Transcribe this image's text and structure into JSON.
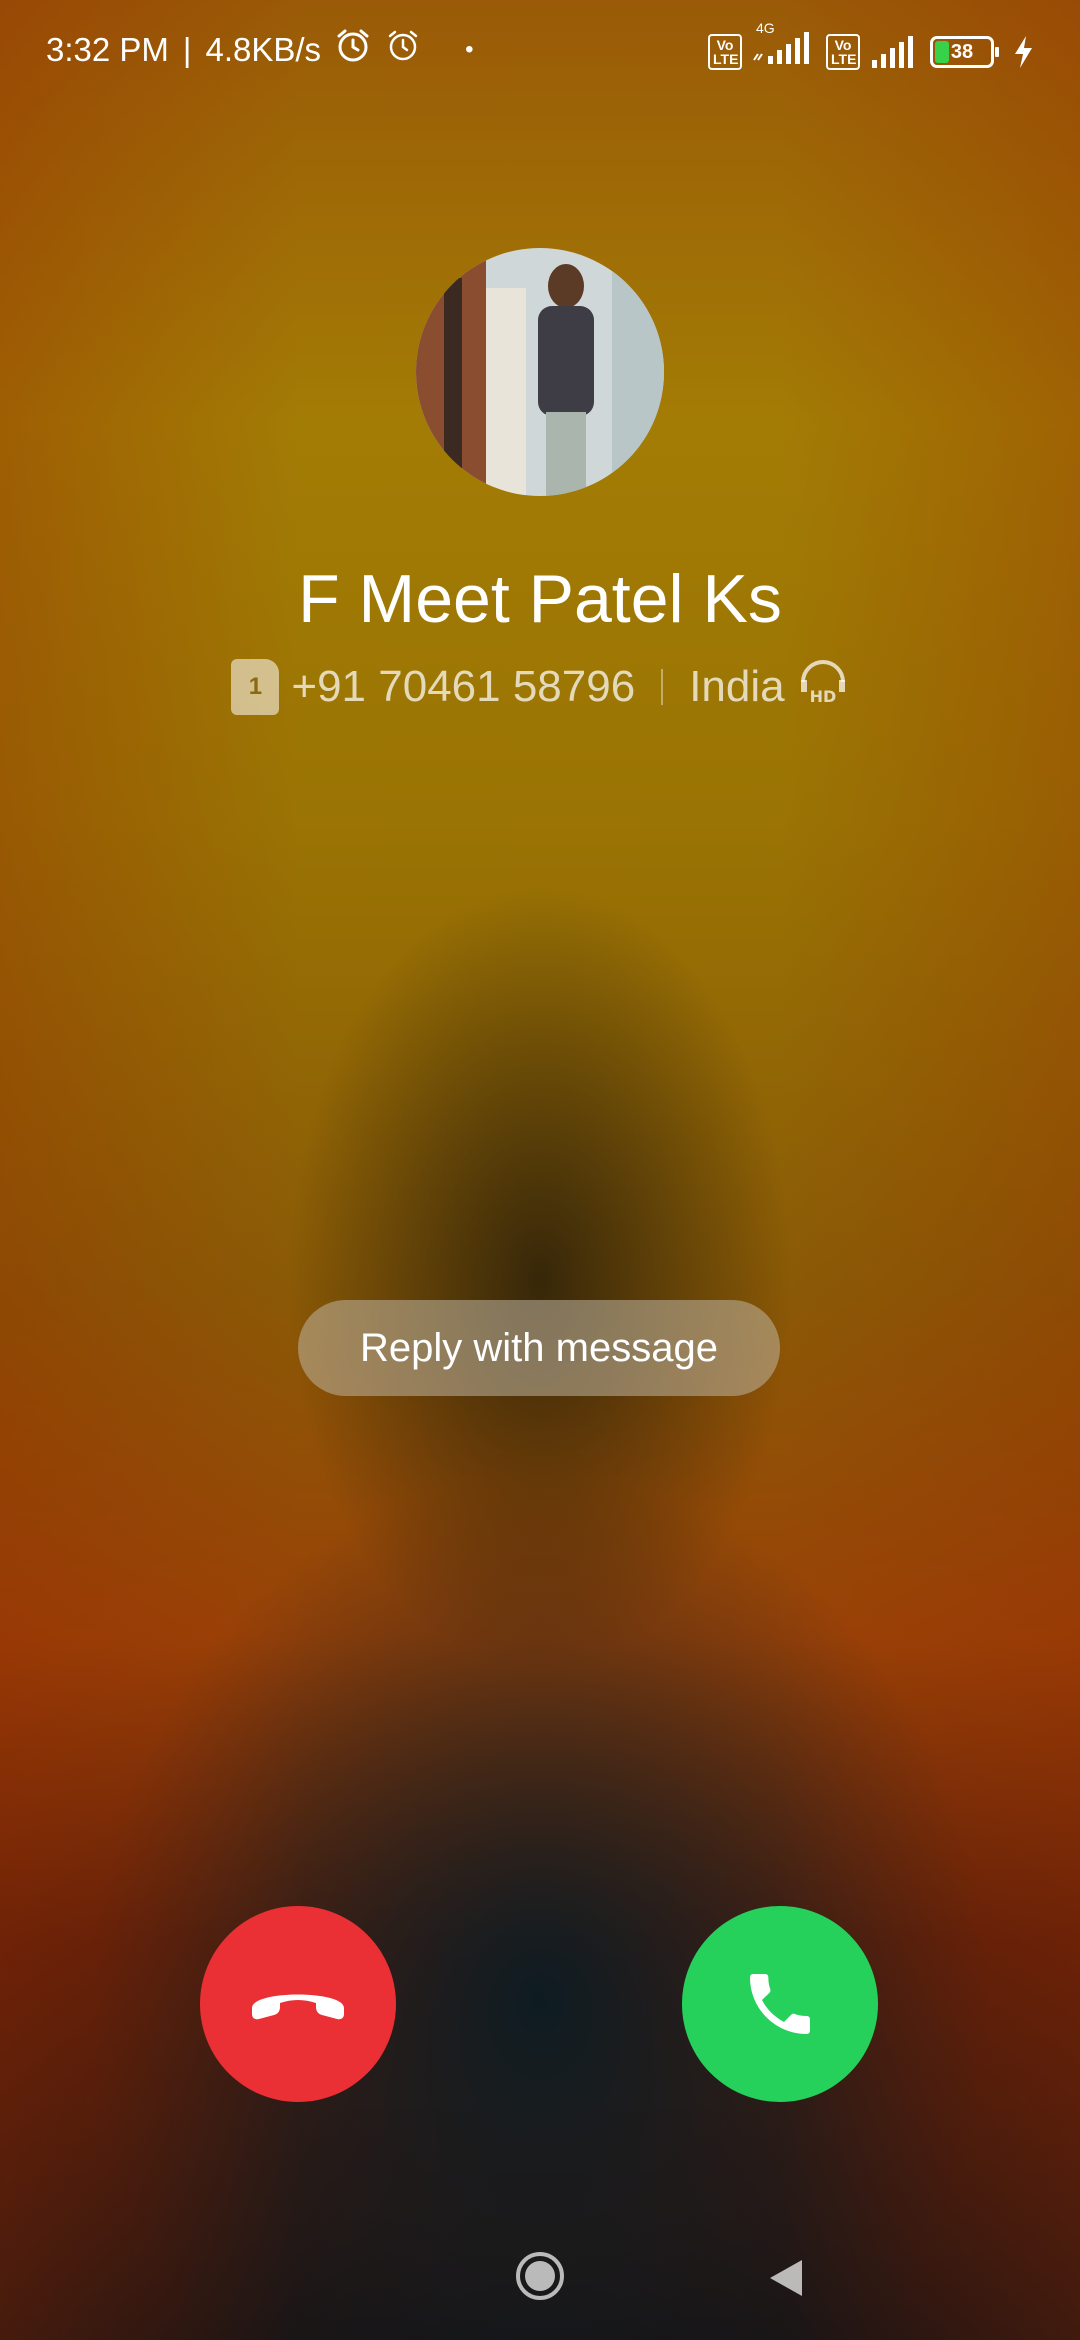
{
  "status_bar": {
    "time": "3:32 PM",
    "separator": "|",
    "net_speed": "4.8KB/s",
    "dot": "•",
    "sim1_volte": "Vo LTE",
    "sim1_network": "4G",
    "sim2_volte": "Vo LTE",
    "battery_level": "38",
    "icons": [
      "alarm-icon",
      "alarm-clock-icon",
      "signal-icon",
      "battery-icon",
      "charging-icon"
    ]
  },
  "caller": {
    "name": "F Meet Patel Ks",
    "sim_slot": "1",
    "number": "+91 70461 58796",
    "region": "India",
    "hd_icon": "hd-voice-icon"
  },
  "actions": {
    "reply_label": "Reply with message",
    "decline_icon": "decline-call-icon",
    "accept_icon": "accept-call-icon"
  },
  "nav": {
    "home_icon": "home-icon",
    "back_icon": "back-icon"
  },
  "colors": {
    "decline": "#ea3035",
    "accept": "#25d15a"
  }
}
